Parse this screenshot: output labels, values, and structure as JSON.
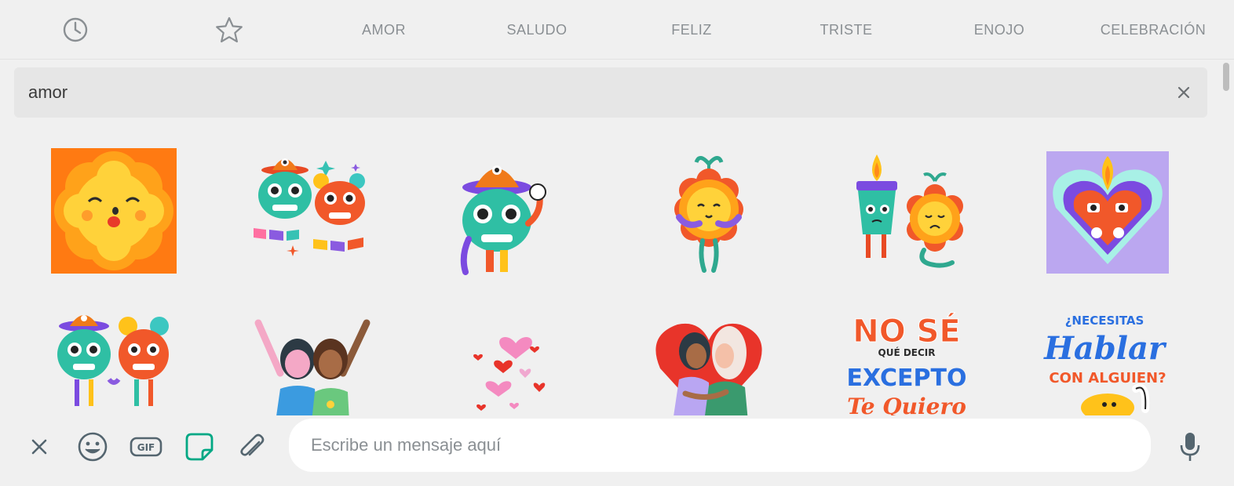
{
  "tabs": [
    {
      "id": "recent",
      "icon": "clock-icon",
      "label": ""
    },
    {
      "id": "favorites",
      "icon": "star-icon",
      "label": ""
    },
    {
      "id": "amor",
      "label": "AMOR"
    },
    {
      "id": "saludo",
      "label": "SALUDO"
    },
    {
      "id": "feliz",
      "label": "FELIZ"
    },
    {
      "id": "triste",
      "label": "TRISTE"
    },
    {
      "id": "enojo",
      "label": "ENOJO"
    },
    {
      "id": "celebracion",
      "label": "CELEBRACIÓN"
    }
  ],
  "search": {
    "value": "amor",
    "clear_icon": "close-icon"
  },
  "stickers": {
    "row1": [
      "flower-kiss",
      "skull-couple-papel-picado",
      "skull-sombrero-wave",
      "marigold-hug",
      "candle-marigold-crying",
      "sacred-heart-love"
    ],
    "row2": [
      "skull-couple-holding-hands",
      "friends-cheering",
      "floating-hearts",
      "couple-heart-hug",
      "no-se-que-decir-sticker",
      "necesitas-hablar-sticker"
    ],
    "text": {
      "nose_line1": "NO SÉ",
      "nose_line2": "QUÉ DECIR",
      "nose_line3": "EXCEPTO",
      "nose_line4": "Te Quiero",
      "hablar_line1": "¿NECESITAS",
      "hablar_line2": "Hablar",
      "hablar_line3": "CON ALGUIEN?"
    }
  },
  "footer": {
    "close_icon": "close-icon",
    "emoji_icon": "emoji-icon",
    "gif_label": "GIF",
    "sticker_icon": "sticker-icon",
    "attach_icon": "paperclip-icon",
    "message_placeholder": "Escribe un mensaje aquí",
    "mic_icon": "microphone-icon"
  },
  "colors": {
    "accent": "#00a884",
    "icon": "#8a8f93",
    "background": "#f0f0f0"
  }
}
